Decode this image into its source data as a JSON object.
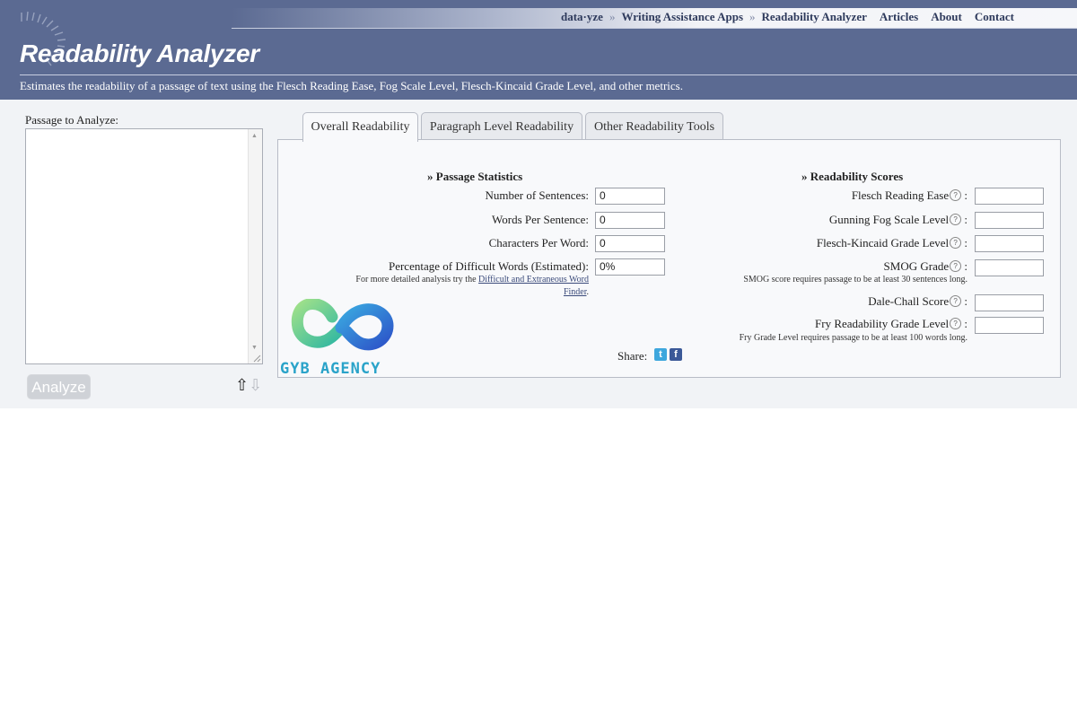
{
  "header": {
    "nav": [
      "data·yze",
      "Writing Assistance Apps",
      "Readability Analyzer",
      "Articles",
      "About",
      "Contact"
    ],
    "nav_separator": "»",
    "title": "Readability Analyzer",
    "description": "Estimates the readability of a passage of text using the Flesch Reading Ease, Fog Scale Level, Flesch-Kincaid Grade Level, and other metrics."
  },
  "passage": {
    "label": "Passage to Analyze:",
    "value": ""
  },
  "analyze_button": "Analyze",
  "tabs": [
    {
      "label": "Overall Readability",
      "active": true
    },
    {
      "label": "Paragraph Level Readability",
      "active": false
    },
    {
      "label": "Other Readability Tools",
      "active": false
    }
  ],
  "passage_statistics": {
    "heading": "» Passage Statistics",
    "rows": [
      {
        "label": "Number of Sentences:",
        "value": "0"
      },
      {
        "label": "Words Per Sentence:",
        "value": "0"
      },
      {
        "label": "Characters Per Word:",
        "value": "0"
      },
      {
        "label": "Percentage of Difficult Words (Estimated):",
        "value": "0%"
      }
    ],
    "note_prefix": "For more detailed analysis try the ",
    "note_link_1": "Difficult and Extraneous Word",
    "note_link_2": "Finder",
    "note_suffix": "."
  },
  "readability_scores": {
    "heading": "» Readability Scores",
    "rows": [
      {
        "label": "Flesch Reading Ease",
        "value": ""
      },
      {
        "label": "Gunning Fog Scale Level",
        "value": ""
      },
      {
        "label": "Flesch-Kincaid Grade Level",
        "value": ""
      },
      {
        "label": "SMOG Grade",
        "value": ""
      },
      {
        "label": "Dale-Chall Score",
        "value": ""
      },
      {
        "label": "Fry Readability Grade Level",
        "value": ""
      }
    ],
    "help_glyph": "?",
    "colon": ":",
    "smog_note": "SMOG score requires passage to be at least 30 sentences long.",
    "fry_note": "Fry Grade Level requires passage to be at least 100 words long."
  },
  "share_label": "Share:",
  "watermark": "GYB AGENCY",
  "colors": {
    "header_bg": "#5b6a92",
    "content_bg": "#f1f3f6",
    "twitter": "#3ea7dd",
    "facebook": "#3b5998"
  }
}
